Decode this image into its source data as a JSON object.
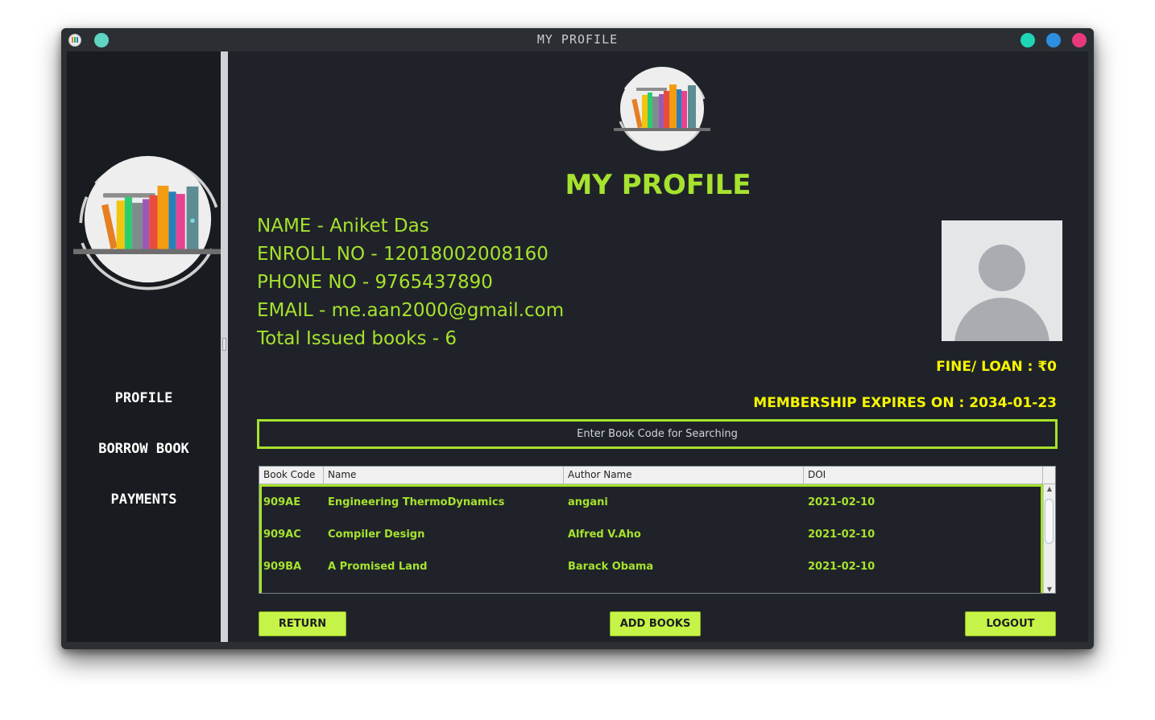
{
  "window": {
    "title": "MY PROFILE",
    "dots": [
      "#1fd5b5",
      "#2e8fe0",
      "#e8397d"
    ],
    "left_dot": "#5fd4c2"
  },
  "sidebar": {
    "logo_icon": "bookshelf-logo-icon",
    "items": [
      {
        "label": "PROFILE"
      },
      {
        "label": "BORROW BOOK"
      },
      {
        "label": "PAYMENTS"
      }
    ]
  },
  "profile": {
    "heading": "MY PROFILE",
    "name_line": "NAME - Aniket Das",
    "enroll_line": "ENROLL NO - 12018002008160",
    "phone_line": "PHONE NO - 9765437890",
    "email_line": "EMAIL - me.aan2000@gmail.com",
    "issued_line": "Total Issued books - 6",
    "avatar_icon": "user-avatar-icon",
    "fine": "FINE/ LOAN : ₹0",
    "membership": "MEMBERSHIP EXPIRES ON : 2034-01-23"
  },
  "search": {
    "placeholder": "Enter Book Code for Searching"
  },
  "table": {
    "columns": [
      "Book Code",
      "Name",
      "Author Name",
      "DOI"
    ],
    "rows": [
      [
        "909AE",
        "Engineering ThermoDynamics",
        "angani",
        "2021-02-10"
      ],
      [
        "909AC",
        "Compiler Design",
        "Alfred V.Aho",
        "2021-02-10"
      ],
      [
        "909BA",
        "A Promised Land",
        "Barack Obama",
        "2021-02-10"
      ]
    ]
  },
  "buttons": {
    "return_label": "RETURN",
    "add_books_label": "ADD BOOKS",
    "logout_label": "LOGOUT"
  },
  "colors": {
    "accent_green": "#a6e22e",
    "accent_yellow": "#f5f500",
    "button_fill": "#c6f347",
    "panel_bg": "#1f2329",
    "sidebar_bg": "#181b1f"
  }
}
